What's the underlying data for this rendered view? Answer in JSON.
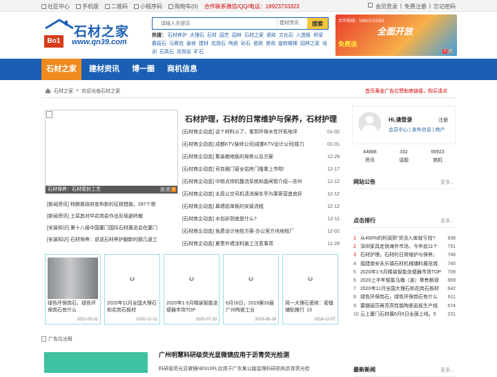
{
  "topbar": {
    "links": [
      "社区中心",
      "手机版",
      "二维码",
      "小程序码",
      "购物车(0)"
    ],
    "hotline": "合作联系微信/QQ/电话：18923733323",
    "right": [
      "会员登录",
      "|",
      "免费注册",
      "|",
      "忘记密码"
    ]
  },
  "logo": {
    "name": "石材之家",
    "badge": "Bo1",
    "url": "www.qn39.com"
  },
  "search": {
    "placeholder": "请输入关键词",
    "scope": "建材资讯",
    "button": "搜索",
    "hot_label": "热搜：",
    "hot_words": [
      "石材养护",
      "大理石",
      "石材",
      "园艺",
      "园林",
      "石材之家",
      "瓷砖",
      "文化石",
      "入造板",
      "桥梁",
      "蘑菇石",
      "马赛克",
      "装修",
      "建材",
      "花岗石",
      "陶瓷",
      "砂石",
      "瓷砖",
      "景观",
      "旋转楼梯",
      "园林之家",
      "培训",
      "石英石",
      "花岗岩",
      "矿石"
    ]
  },
  "ad": {
    "line1": "合作热线：18923733323",
    "line2": "全面开放",
    "line3": "免费送"
  },
  "nav": {
    "items": [
      "石材之家",
      "建材资讯",
      "博一圈",
      "商机信息"
    ]
  },
  "crumb": {
    "home": "石材之家",
    "sep": ">",
    "current": "欢迎光临石材之家",
    "notice": "首页黄金广告位赞助商链接，购买请点"
  },
  "slider": {
    "caption": "石材保养：石材密封工艺",
    "pages": [
      "1",
      "2",
      "3"
    ]
  },
  "headline": "石材护理，石材的日常维护与保养，石材护理",
  "news": [
    {
      "title": "[石材商企动态] 这个材料火了，看到环保水性环氧地坪",
      "date": "01-02"
    },
    {
      "title": "[石材商企动态] 成都KTV装修公司|成都KTV设计公司|极力",
      "date": "01-01"
    },
    {
      "title": "[石材商企动态] 集装箱地板的局势以及方案",
      "date": "12-29"
    },
    {
      "title": "[石材商企动态] 司克雅门窗全铝房门隆重上市啦!",
      "date": "12-17"
    },
    {
      "title": "[石材商企动态] 中频点焊机整流系统和晶闸管介绍—苏州",
      "date": "12-12"
    },
    {
      "title": "[石材商企动态] 太原公交司机清洗候车亭为乘客营造良好",
      "date": "12-12"
    },
    {
      "title": "[石材商企动态] 幕墙铝单板的安装流程",
      "date": "12-12"
    },
    {
      "title": "[石材商企动态] 水包砂到底是什么?",
      "date": "12-11"
    },
    {
      "title": "[石材商企动态] 免费设计地毯方案-办公室方块地毯厂",
      "date": "12-02"
    },
    {
      "title": "[石材商企动态] 夏季外墙涂料施工注意事项",
      "date": "11-28"
    }
  ],
  "news_left": [
    "[新闻资讯] 特朗普政府宣布新的征税措施，297个税",
    "[新闻资讯] 土耳其对华花岗岩作出反规避终裁",
    "[安装知识] 第十八届中国厦门国际石材展览会在厦门",
    "[安装知识] 石材保养：说说石材养护翻新的那几道工"
  ],
  "cards": [
    {
      "title": "绿色环保岗石，绿色环保岗石有什么",
      "date": "2021-05-31"
    },
    {
      "title": "2020年11月全国大理石和花岗石板材",
      "date": "2020-12-21"
    },
    {
      "title": "2020年1-5月精装智能坐便器市场TOP",
      "date": "2020-07-10"
    },
    {
      "title": "6月18日，2019第33届广州陶瓷工业",
      "date": "2019-06-18"
    },
    {
      "title": "简一大理石瓷砖：密缝铺贴推行《3",
      "date": "2018-12-07"
    }
  ],
  "banner_slot": "广告位出租",
  "story": {
    "title": "广州明慧科研级荧光显微镜应用于沥青荧光检测",
    "text": "科研级荧光显微镜NE910FL应用于广东某公路监理科研机构沥青荧光检"
  },
  "user": {
    "greeting": "Hi,请登录",
    "register": "注册",
    "links": [
      "会员中心",
      "|",
      "发布信息",
      "|",
      "商户"
    ]
  },
  "stats": [
    {
      "value": "44888",
      "label": "资讯"
    },
    {
      "value": "332",
      "label": "话题"
    },
    {
      "value": "66923",
      "label": "商机"
    }
  ],
  "side_sections": {
    "notice": "网站公告",
    "rank": "点击排行",
    "latest": "最新新闻",
    "more": "更多..."
  },
  "rank": [
    {
      "n": "1",
      "title": "从400%的利润到\"货没入库就亏钱\"!",
      "views": "938"
    },
    {
      "n": "2",
      "title": "深圳家具走俏海外市场，今年前11个",
      "views": "791"
    },
    {
      "n": "3",
      "title": "石材护理，石材的日常维护与保养，",
      "views": "746"
    },
    {
      "n": "4",
      "title": "福建南安永乐镇石材机械铺料展览城",
      "views": "745"
    },
    {
      "n": "5",
      "title": "2020年1-5月精装智能坐便器市场TOP",
      "views": "709"
    },
    {
      "n": "6",
      "title": "2020上半年智能马桶（盖）零售额规",
      "views": "669"
    },
    {
      "n": "7",
      "title": "2020年11月全国大理石和花岗石板材",
      "views": "642"
    },
    {
      "n": "8",
      "title": "绿色环保岗石，绿色环保岗石有什么",
      "views": "611"
    },
    {
      "n": "9",
      "title": "要娜丽莎再亮高性能陶瓷岩板生产线",
      "views": "574"
    },
    {
      "n": "10",
      "title": "云上厦门石材展6月6日全面上线，5",
      "views": "231"
    }
  ],
  "colors": {
    "brand": "#1a5fb4",
    "accent": "#f08a1e",
    "alert": "#d40000"
  }
}
